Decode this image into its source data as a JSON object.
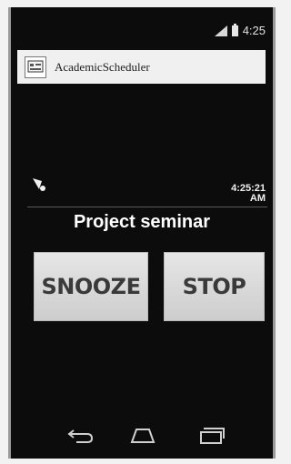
{
  "status_bar": {
    "time": "4:25"
  },
  "action_bar": {
    "title": "AcademicScheduler"
  },
  "alarm": {
    "time": "4:25:21",
    "ampm": "AM"
  },
  "event_title": "Project seminar",
  "buttons": {
    "snooze": "SNOOZE",
    "stop": "STOP"
  },
  "nav": {
    "back_icon": "back-icon",
    "home_icon": "home-icon",
    "recent_icon": "recent-apps-icon"
  }
}
